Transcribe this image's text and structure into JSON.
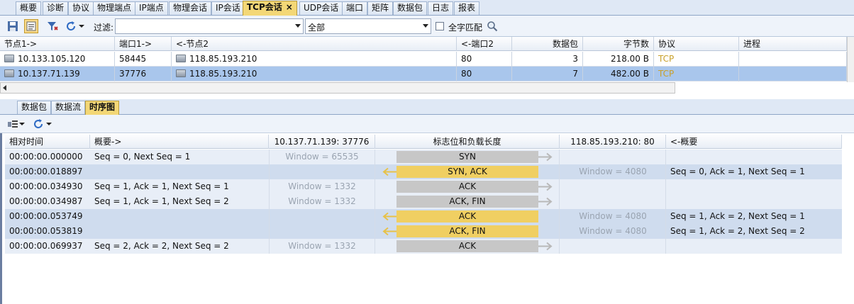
{
  "tabs": [
    {
      "label": "概要"
    },
    {
      "label": "诊断"
    },
    {
      "label": "协议"
    },
    {
      "label": "物理端点"
    },
    {
      "label": "IP端点"
    },
    {
      "label": "物理会话"
    },
    {
      "label": "IP会话"
    },
    {
      "label": "TCP会话",
      "active": true,
      "close": "×"
    },
    {
      "label": "UDP会话"
    },
    {
      "label": "端口"
    },
    {
      "label": "矩阵"
    },
    {
      "label": "数据包"
    },
    {
      "label": "日志"
    },
    {
      "label": "报表"
    }
  ],
  "toolbar": {
    "filter_label": "过滤:",
    "filter_value": "",
    "scope_value": "全部",
    "whole_word_label": "全字匹配"
  },
  "grid": {
    "headers": [
      "节点1->",
      "端口1->",
      "<-节点2",
      "<-端口2",
      "数据包",
      "字节数",
      "协议",
      "进程"
    ],
    "rows": [
      {
        "node1": "10.133.105.120",
        "port1": "58445",
        "node2": "118.85.193.210",
        "port2": "80",
        "packets": "3",
        "bytes": "218.00 B",
        "protocol": "TCP",
        "process": ""
      },
      {
        "node1": "10.137.71.139",
        "port1": "37776",
        "node2": "118.85.193.210",
        "port2": "80",
        "packets": "7",
        "bytes": "482.00 B",
        "protocol": "TCP",
        "process": "",
        "selected": true
      }
    ]
  },
  "subtabs": [
    {
      "label": "数据包"
    },
    {
      "label": "数据流"
    },
    {
      "label": "时序图",
      "active": true
    }
  ],
  "sequence": {
    "headers": [
      "相对时间",
      "概要->",
      "10.137.71.139: 37776",
      "标志位和负载长度",
      "118.85.193.210: 80",
      "<-概要"
    ],
    "rows": [
      {
        "time": "00:00:00.000000",
        "summary_out": "Seq = 0, Next Seq = 1",
        "window_left": "Window = 65535",
        "flags": "SYN",
        "dir": "out",
        "window_right": "",
        "summary_in": ""
      },
      {
        "time": "00:00:00.018897",
        "summary_out": "",
        "window_left": "",
        "flags": "SYN, ACK",
        "dir": "in",
        "window_right": "Window = 4080",
        "summary_in": "Seq = 0, Ack = 1, Next Seq = 1"
      },
      {
        "time": "00:00:00.034930",
        "summary_out": "Seq = 1, Ack = 1, Next Seq = 1",
        "window_left": "Window = 1332",
        "flags": "ACK",
        "dir": "out",
        "window_right": "",
        "summary_in": ""
      },
      {
        "time": "00:00:00.034987",
        "summary_out": "Seq = 1, Ack = 1, Next Seq = 2",
        "window_left": "Window = 1332",
        "flags": "ACK, FIN",
        "dir": "out",
        "window_right": "",
        "summary_in": ""
      },
      {
        "time": "00:00:00.053749",
        "summary_out": "",
        "window_left": "",
        "flags": "ACK",
        "dir": "in",
        "window_right": "Window = 4080",
        "summary_in": "Seq = 1, Ack = 2, Next Seq = 1"
      },
      {
        "time": "00:00:00.053819",
        "summary_out": "",
        "window_left": "",
        "flags": "ACK, FIN",
        "dir": "in",
        "window_right": "Window = 4080",
        "summary_in": "Seq = 1, Ack = 2, Next Seq = 2"
      },
      {
        "time": "00:00:00.069937",
        "summary_out": "Seq = 2, Ack = 2, Next Seq = 2",
        "window_left": "Window = 1332",
        "flags": "ACK",
        "dir": "out",
        "window_right": "",
        "summary_in": ""
      }
    ]
  },
  "colors": {
    "out_flag": "#c7c7c7",
    "in_flag": "#f0cf62",
    "selected_row": "#a9c6ec",
    "protocol": "#c8a02a"
  },
  "icons": [
    "save-icon",
    "open-icon",
    "filter-icon",
    "refresh-icon",
    "search-icon",
    "node-icon",
    "layout-icon"
  ]
}
